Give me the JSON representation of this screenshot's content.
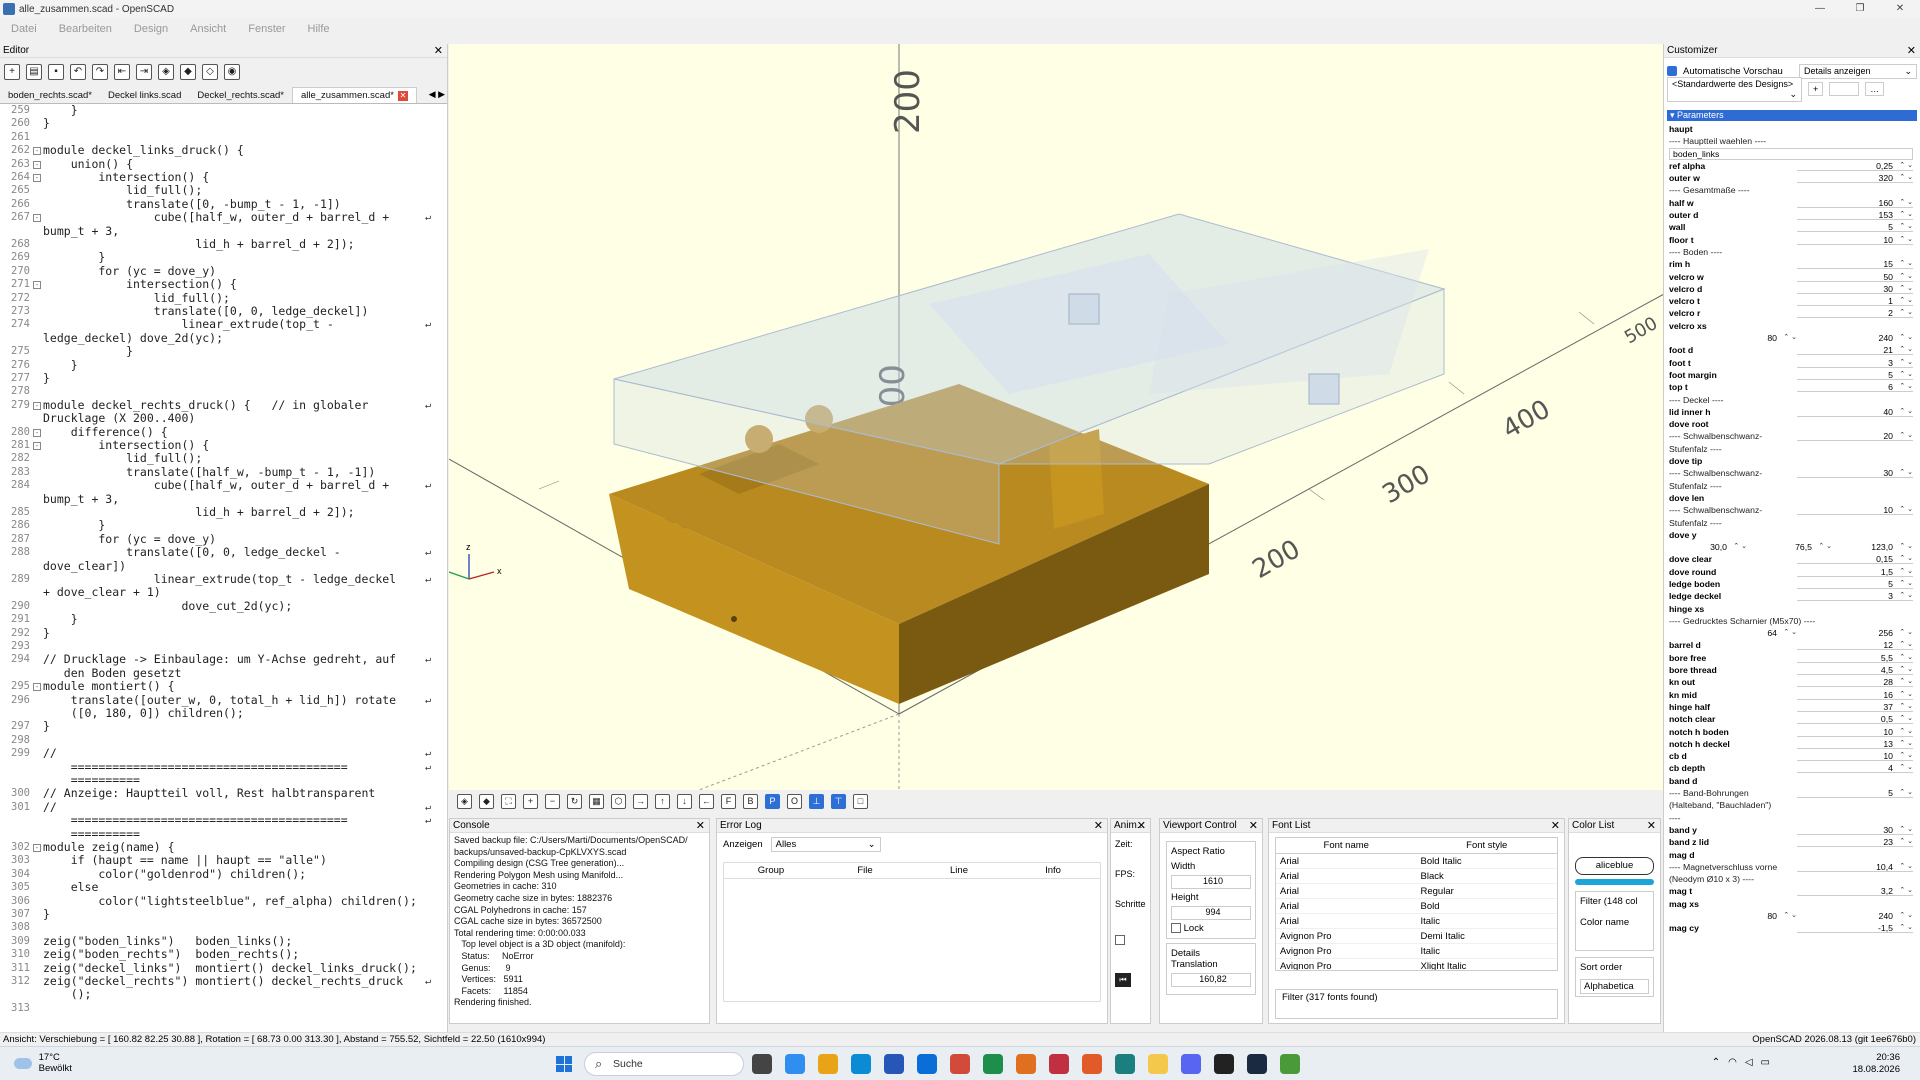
{
  "window": {
    "title": "alle_zusammen.scad - OpenSCAD"
  },
  "menu": [
    "Datei",
    "Bearbeiten",
    "Design",
    "Ansicht",
    "Fenster",
    "Hilfe"
  ],
  "editor": {
    "title": "Editor",
    "tabs": [
      "boden_rechts.scad*",
      "Deckel links.scad",
      "Deckel_rechts.scad*",
      "alle_zusammen.scad*"
    ],
    "lines": [
      {
        "n": "259",
        "t": "    }",
        "f": ""
      },
      {
        "n": "260",
        "t": "}",
        "f": ""
      },
      {
        "n": "261",
        "t": "",
        "f": ""
      },
      {
        "n": "262",
        "t": "module deckel_links_druck() {",
        "f": "-"
      },
      {
        "n": "263",
        "t": "    union() {",
        "f": "-"
      },
      {
        "n": "264",
        "t": "        intersection() {",
        "f": "-"
      },
      {
        "n": "265",
        "t": "            lid_full();",
        "f": ""
      },
      {
        "n": "266",
        "t": "            translate([0, -bump_t - 1, -1])",
        "f": ""
      },
      {
        "n": "267",
        "t": "                cube([half_w, outer_d + barrel_d +",
        "f": "-",
        "w": true
      },
      {
        "n": "",
        "t": "bump_t + 3,",
        "f": ""
      },
      {
        "n": "268",
        "t": "                      lid_h + barrel_d + 2]);",
        "f": ""
      },
      {
        "n": "269",
        "t": "        }",
        "f": ""
      },
      {
        "n": "270",
        "t": "        for (yc = dove_y)",
        "f": ""
      },
      {
        "n": "271",
        "t": "            intersection() {",
        "f": "-"
      },
      {
        "n": "272",
        "t": "                lid_full();",
        "f": ""
      },
      {
        "n": "273",
        "t": "                translate([0, 0, ledge_deckel])",
        "f": ""
      },
      {
        "n": "274",
        "t": "                    linear_extrude(top_t -",
        "f": "",
        "w": true
      },
      {
        "n": "",
        "t": "ledge_deckel) dove_2d(yc);",
        "f": ""
      },
      {
        "n": "275",
        "t": "            }",
        "f": ""
      },
      {
        "n": "276",
        "t": "    }",
        "f": ""
      },
      {
        "n": "277",
        "t": "}",
        "f": ""
      },
      {
        "n": "278",
        "t": "",
        "f": ""
      },
      {
        "n": "279",
        "t": "module deckel_rechts_druck() {   // in globaler",
        "f": "-",
        "w": true
      },
      {
        "n": "",
        "t": "Drucklage (X 200..400)",
        "f": ""
      },
      {
        "n": "280",
        "t": "    difference() {",
        "f": "-"
      },
      {
        "n": "281",
        "t": "        intersection() {",
        "f": "-"
      },
      {
        "n": "282",
        "t": "            lid_full();",
        "f": ""
      },
      {
        "n": "283",
        "t": "            translate([half_w, -bump_t - 1, -1])",
        "f": ""
      },
      {
        "n": "284",
        "t": "                cube([half_w, outer_d + barrel_d +",
        "f": "",
        "w": true
      },
      {
        "n": "",
        "t": "bump_t + 3,",
        "f": ""
      },
      {
        "n": "285",
        "t": "                      lid_h + barrel_d + 2]);",
        "f": ""
      },
      {
        "n": "286",
        "t": "        }",
        "f": ""
      },
      {
        "n": "287",
        "t": "        for (yc = dove_y)",
        "f": ""
      },
      {
        "n": "288",
        "t": "            translate([0, 0, ledge_deckel -",
        "f": "",
        "w": true
      },
      {
        "n": "",
        "t": "dove_clear])",
        "f": ""
      },
      {
        "n": "289",
        "t": "                linear_extrude(top_t - ledge_deckel",
        "f": "",
        "w": true
      },
      {
        "n": "",
        "t": "+ dove_clear + 1)",
        "f": ""
      },
      {
        "n": "290",
        "t": "                    dove_cut_2d(yc);",
        "f": ""
      },
      {
        "n": "291",
        "t": "    }",
        "f": ""
      },
      {
        "n": "292",
        "t": "}",
        "f": ""
      },
      {
        "n": "293",
        "t": "",
        "f": ""
      },
      {
        "n": "294",
        "t": "// Drucklage -> Einbaulage: um Y-Achse gedreht, auf",
        "f": "",
        "w": true
      },
      {
        "n": "",
        "t": "   den Boden gesetzt",
        "f": ""
      },
      {
        "n": "295",
        "t": "module montiert() {",
        "f": "-"
      },
      {
        "n": "296",
        "t": "    translate([outer_w, 0, total_h + lid_h]) rotate",
        "f": "",
        "w": true
      },
      {
        "n": "",
        "t": "    ([0, 180, 0]) children();",
        "f": ""
      },
      {
        "n": "297",
        "t": "}",
        "f": ""
      },
      {
        "n": "298",
        "t": "",
        "f": ""
      },
      {
        "n": "299",
        "t": "//",
        "f": "",
        "w": true
      },
      {
        "n": "",
        "t": "    ========================================",
        "f": "",
        "w": true
      },
      {
        "n": "",
        "t": "    ==========",
        "f": ""
      },
      {
        "n": "300",
        "t": "// Anzeige: Hauptteil voll, Rest halbtransparent",
        "f": ""
      },
      {
        "n": "301",
        "t": "//",
        "f": "",
        "w": true
      },
      {
        "n": "",
        "t": "    ========================================",
        "f": "",
        "w": true
      },
      {
        "n": "",
        "t": "    ==========",
        "f": ""
      },
      {
        "n": "302",
        "t": "module zeig(name) {",
        "f": "-"
      },
      {
        "n": "303",
        "t": "    if (haupt == name || haupt == \"alle\")",
        "f": ""
      },
      {
        "n": "304",
        "t": "        color(\"goldenrod\") children();",
        "f": ""
      },
      {
        "n": "305",
        "t": "    else",
        "f": ""
      },
      {
        "n": "306",
        "t": "        color(\"lightsteelblue\", ref_alpha) children();",
        "f": ""
      },
      {
        "n": "307",
        "t": "}",
        "f": ""
      },
      {
        "n": "308",
        "t": "",
        "f": ""
      },
      {
        "n": "309",
        "t": "zeig(\"boden_links\")   boden_links();",
        "f": ""
      },
      {
        "n": "310",
        "t": "zeig(\"boden_rechts\")  boden_rechts();",
        "f": ""
      },
      {
        "n": "311",
        "t": "zeig(\"deckel_links\")  montiert() deckel_links_druck();",
        "f": ""
      },
      {
        "n": "312",
        "t": "zeig(\"deckel_rechts\") montiert() deckel_rechts_druck",
        "f": "",
        "w": true
      },
      {
        "n": "",
        "t": "    ();",
        "f": ""
      },
      {
        "n": "313",
        "t": "",
        "f": ""
      }
    ]
  },
  "viewport": {
    "axis_ticks": [
      "200",
      "100",
      "200",
      "300",
      "400",
      "200",
      "100",
      "500"
    ],
    "axes": {
      "x": "x",
      "y": "y",
      "z": "z"
    }
  },
  "console": {
    "title": "Console",
    "text": "Saved backup file: C:/Users/Marti/Documents/OpenSCAD/\nbackups/unsaved-backup-CpKLVXYS.scad\nCompiling design (CSG Tree generation)...\nRendering Polygon Mesh using Manifold...\nGeometries in cache: 310\nGeometry cache size in bytes: 1882376\nCGAL Polyhedrons in cache: 157\nCGAL cache size in bytes: 36572500\nTotal rendering time: 0:00:00.033\n   Top level object is a 3D object (manifold):\n   Status:     NoError\n   Genus:      9\n   Vertices:   5911\n   Facets:     11854\nRendering finished."
  },
  "errorlog": {
    "title": "Error Log",
    "show_label": "Anzeigen",
    "show_value": "Alles",
    "columns": [
      "Group",
      "File",
      "Line",
      "Info"
    ]
  },
  "anim": {
    "title": "Anim...",
    "labels": [
      "Zeit:",
      "FPS:",
      "Schritte"
    ]
  },
  "vpctrl": {
    "title": "Viewport Control",
    "aspect": "Aspect Ratio",
    "width_label": "Width",
    "width": "1610",
    "height_label": "Height",
    "height": "994",
    "lock": "Lock",
    "details": "Details",
    "translation": "Translation",
    "trans_val": "160,82"
  },
  "fontlist": {
    "title": "Font List",
    "columns": [
      "Font name",
      "Font style"
    ],
    "rows": [
      [
        "Arial",
        "Bold Italic"
      ],
      [
        "Arial",
        "Black"
      ],
      [
        "Arial",
        "Regular"
      ],
      [
        "Arial",
        "Bold"
      ],
      [
        "Arial",
        "Italic"
      ],
      [
        "Avignon Pro",
        "Demi Italic"
      ],
      [
        "Avignon Pro",
        "Italic"
      ],
      [
        "Avignon Pro",
        "Xlight Italic"
      ]
    ],
    "filter": "Filter (317 fonts found)"
  },
  "colorlist": {
    "title": "Color List",
    "button": "aliceblue",
    "filter": "Filter (148 col",
    "colorname": "Color name",
    "sort": "Sort order",
    "sortval": "Alphabetica"
  },
  "customizer": {
    "title": "Customizer",
    "autopreview": "Automatische Vorschau",
    "details": "Details anzeigen",
    "preset": "<Standardwerte des Designs>",
    "section": "Parameters",
    "params": [
      {
        "type": "name",
        "label": "haupt"
      },
      {
        "type": "desc",
        "label": "---- Hauptteil waehlen ----"
      },
      {
        "type": "text",
        "value": "boden_links"
      },
      {
        "type": "num",
        "label": "ref alpha",
        "value": "0,25"
      },
      {
        "type": "num",
        "label": "outer w",
        "value": "320"
      },
      {
        "type": "desc",
        "label": "---- Gesamtmaße ----"
      },
      {
        "type": "num",
        "label": "half w",
        "value": "160"
      },
      {
        "type": "num",
        "label": "outer d",
        "value": "153"
      },
      {
        "type": "num",
        "label": "wall",
        "value": "5"
      },
      {
        "type": "num",
        "label": "floor t",
        "value": "10"
      },
      {
        "type": "desc",
        "label": "---- Boden ----"
      },
      {
        "type": "num",
        "label": "rim h",
        "value": "15"
      },
      {
        "type": "num",
        "label": "velcro w",
        "value": "50"
      },
      {
        "type": "num",
        "label": "velcro d",
        "value": "30"
      },
      {
        "type": "num",
        "label": "velcro t",
        "value": "1"
      },
      {
        "type": "num",
        "label": "velcro r",
        "value": "2"
      },
      {
        "type": "name",
        "label": "velcro xs"
      },
      {
        "type": "multi",
        "values": [
          "80",
          "240"
        ]
      },
      {
        "type": "num",
        "label": "foot d",
        "value": "21"
      },
      {
        "type": "num",
        "label": "foot t",
        "value": "3"
      },
      {
        "type": "num",
        "label": "foot margin",
        "value": "5"
      },
      {
        "type": "num",
        "label": "top t",
        "value": "6"
      },
      {
        "type": "desc",
        "label": "---- Deckel ----"
      },
      {
        "type": "num",
        "label": "lid inner h",
        "value": "40"
      },
      {
        "type": "name",
        "label": "dove root"
      },
      {
        "type": "descnum",
        "label": "---- Schwalbenschwanz-",
        "value": "20"
      },
      {
        "type": "desc",
        "label": "Stufenfalz ----"
      },
      {
        "type": "name",
        "label": "dove tip"
      },
      {
        "type": "descnum",
        "label": "---- Schwalbenschwanz-",
        "value": "30"
      },
      {
        "type": "desc",
        "label": "Stufenfalz ----"
      },
      {
        "type": "name",
        "label": "dove len"
      },
      {
        "type": "descnum",
        "label": "---- Schwalbenschwanz-",
        "value": "10"
      },
      {
        "type": "desc",
        "label": "Stufenfalz ----"
      },
      {
        "type": "name",
        "label": "dove y"
      },
      {
        "type": "multi3",
        "values": [
          "30,0",
          "76,5",
          "123,0"
        ]
      },
      {
        "type": "num",
        "label": "dove clear",
        "value": "0,15"
      },
      {
        "type": "num",
        "label": "dove round",
        "value": "1,5"
      },
      {
        "type": "num",
        "label": "ledge boden",
        "value": "5"
      },
      {
        "type": "num",
        "label": "ledge deckel",
        "value": "3"
      },
      {
        "type": "name",
        "label": "hinge xs"
      },
      {
        "type": "desc",
        "label": "---- Gedrucktes Scharnier (M5x70) ----"
      },
      {
        "type": "multi",
        "values": [
          "64",
          "256"
        ]
      },
      {
        "type": "num",
        "label": "barrel d",
        "value": "12"
      },
      {
        "type": "num",
        "label": "bore free",
        "value": "5,5"
      },
      {
        "type": "num",
        "label": "bore thread",
        "value": "4,5"
      },
      {
        "type": "num",
        "label": "kn out",
        "value": "28"
      },
      {
        "type": "num",
        "label": "kn mid",
        "value": "16"
      },
      {
        "type": "num",
        "label": "hinge half",
        "value": "37"
      },
      {
        "type": "num",
        "label": "notch clear",
        "value": "0,5"
      },
      {
        "type": "num",
        "label": "notch h boden",
        "value": "10"
      },
      {
        "type": "num",
        "label": "notch h deckel",
        "value": "13"
      },
      {
        "type": "num",
        "label": "cb d",
        "value": "10"
      },
      {
        "type": "num",
        "label": "cb depth",
        "value": "4"
      },
      {
        "type": "name",
        "label": "band d"
      },
      {
        "type": "descnum",
        "label": "---- Band-Bohrungen",
        "value": "5"
      },
      {
        "type": "desc",
        "label": "(Halteband, \"Bauchladen\")"
      },
      {
        "type": "desc",
        "label": "----"
      },
      {
        "type": "num",
        "label": "band y",
        "value": "30"
      },
      {
        "type": "num",
        "label": "band z lid",
        "value": "23"
      },
      {
        "type": "name",
        "label": "mag d"
      },
      {
        "type": "descnum",
        "label": "---- Magnetverschluss vorne",
        "value": "10,4"
      },
      {
        "type": "desc",
        "label": "(Neodym Ø10 x 3) ----"
      },
      {
        "type": "num",
        "label": "mag t",
        "value": "3,2"
      },
      {
        "type": "name",
        "label": "mag xs"
      },
      {
        "type": "multi",
        "values": [
          "80",
          "240"
        ]
      },
      {
        "type": "num",
        "label": "mag cy",
        "value": "-1,5"
      }
    ]
  },
  "statusbar": {
    "left": "Ansicht: Verschiebung = [ 160.82 82.25 30.88 ], Rotation = [ 68.73 0.00 313.30 ], Abstand = 755.52, Sichtfeld = 22.50 (1610x994)",
    "right": "OpenSCAD 2026.08.13 (git 1ee676b0)"
  },
  "taskbar": {
    "temp": "17°C",
    "weather": "Bewölkt",
    "search": "Suche",
    "time": "20:36",
    "date": "18.08.2026"
  }
}
